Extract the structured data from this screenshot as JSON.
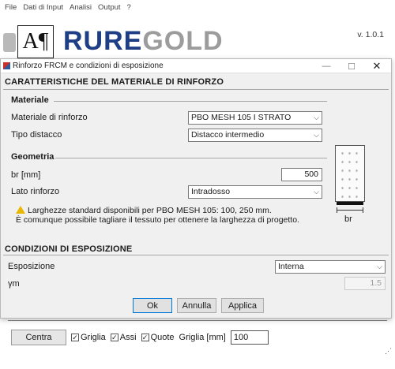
{
  "main_window": {
    "menu": [
      "File",
      "Dati di Input",
      "Analisi",
      "Output",
      "?"
    ],
    "logo_box_glyph": "A¶",
    "logo": {
      "blue": "RURE",
      "gold": "GOLD"
    },
    "version": "v. 1.0.1",
    "toolbar": {
      "centra_label": "Centra",
      "griglia_check": {
        "label": "Griglia",
        "checked": true
      },
      "assi_check": {
        "label": "Assi",
        "checked": true
      },
      "quote_check": {
        "label": "Quote",
        "checked": true
      },
      "griglia_mm_label": "Griglia [mm]",
      "griglia_mm_value": "100"
    }
  },
  "dialog": {
    "title": "Rinforzo FRCM e condizioni di esposizione",
    "section_material": {
      "header": "CARATTERISTICHE DEL MATERIALE DI RINFORZO",
      "materiale": {
        "header": "Materiale",
        "materiale_label": "Materiale di rinforzo",
        "materiale_value": "PBO MESH 105 I STRATO",
        "distacco_label": "Tipo distacco",
        "distacco_value": "Distacco intermedio"
      },
      "geometria": {
        "header": "Geometria",
        "br_label": "br [mm]",
        "br_value": "500",
        "lato_label": "Lato rinforzo",
        "lato_value": "Intradosso",
        "warning_line1": "Larghezze standard disponibili per PBO MESH 105: 100, 250 mm.",
        "warning_line2": "È comunque possibile tagliare il tessuto per ottenere la larghezza di progetto.",
        "diagram_label": "br"
      }
    },
    "section_exposure": {
      "header": "CONDIZIONI DI ESPOSIZIONE",
      "esposizione_label": "Esposizione",
      "esposizione_value": "Interna",
      "gamma_label": "γm",
      "gamma_value": "1.5"
    },
    "buttons": {
      "ok": "Ok",
      "annulla": "Annulla",
      "applica": "Applica"
    }
  },
  "colors": {
    "logo_blue": "#1e3f86",
    "logo_gold": "#9c9c9c",
    "warning": "#e8b700",
    "accent_focus": "#0078d7"
  }
}
